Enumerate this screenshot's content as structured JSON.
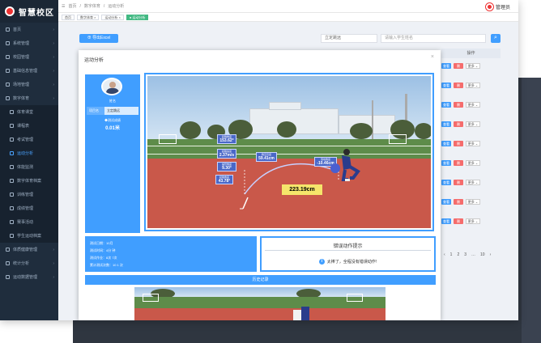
{
  "app": {
    "logo_text": "智慧校区",
    "user": "管理员"
  },
  "breadcrumb": [
    "首页",
    "数字体育",
    "运动分析"
  ],
  "tags": [
    {
      "label": "首页",
      "active": false
    },
    {
      "label": "数字体育 ×",
      "active": false
    },
    {
      "label": "运动分析 ×",
      "active": false
    },
    {
      "label": "● 运动分析",
      "active": true
    }
  ],
  "sidebar": {
    "items": [
      {
        "label": "首页",
        "sub": false,
        "active": false
      },
      {
        "label": "系统管理",
        "sub": false,
        "active": false
      },
      {
        "label": "校园管理",
        "sub": false,
        "active": false
      },
      {
        "label": "基础信息管理",
        "sub": false,
        "active": false
      },
      {
        "label": "场地管理",
        "sub": false,
        "active": false
      },
      {
        "label": "数字体育",
        "sub": false,
        "active": false
      },
      {
        "label": "体育课堂",
        "sub": true,
        "active": false
      },
      {
        "label": "课程表",
        "sub": true,
        "active": false
      },
      {
        "label": "考试管理",
        "sub": true,
        "active": false
      },
      {
        "label": "运动分析",
        "sub": true,
        "active": true
      },
      {
        "label": "体能监测",
        "sub": true,
        "active": false
      },
      {
        "label": "数字体育档案",
        "sub": true,
        "active": false
      },
      {
        "label": "训练管理",
        "sub": true,
        "active": false
      },
      {
        "label": "成绩管理",
        "sub": true,
        "active": false
      },
      {
        "label": "赛事活动",
        "sub": true,
        "active": false
      },
      {
        "label": "学生运动档案",
        "sub": true,
        "active": false
      },
      {
        "label": "体质健康管理",
        "sub": false,
        "active": false
      },
      {
        "label": "统计分析",
        "sub": false,
        "active": false
      },
      {
        "label": "运动数据管理",
        "sub": false,
        "active": false
      }
    ]
  },
  "background": {
    "add_button": "⊕ 导出Excel",
    "select_value": "立定跳远",
    "search_placeholder": "请输入学生姓名",
    "table_header": "操作",
    "row_btn_view": "查看",
    "row_btn_delete": "删",
    "row_btn_more": "更多 ⌄",
    "pager": [
      "‹",
      "1",
      "2",
      "3",
      "…",
      "10",
      "›"
    ]
  },
  "modal": {
    "title": "运动分析",
    "close": "×",
    "profile": {
      "name": "姓名",
      "field_key": "项目名",
      "field_value": "立定跳远",
      "score_label": "◆测试成绩",
      "score_value": "0.01米"
    },
    "measures": [
      {
        "label": "起跳角度",
        "value": "153.62°"
      },
      {
        "label": "起跳速度",
        "value": "2.37m/s"
      },
      {
        "label": "摆臂角度",
        "value": "9.30°"
      },
      {
        "label": "起跳角度",
        "value": "43.78°"
      },
      {
        "label": "腾空高度",
        "value": "59.41cm"
      },
      {
        "label": "落地角度",
        "value": "-10.46cm"
      }
    ],
    "distance": "223.19cm",
    "stats": [
      "测试日期：10月",
      "测试时间：4分 钟",
      "测试作业：8次 7次",
      "累计测试次数：10 1 次"
    ],
    "tips_title": "错误动作提示",
    "tips_message": "太棒了，全程没有错误动作!",
    "history_button": "历史记录"
  }
}
